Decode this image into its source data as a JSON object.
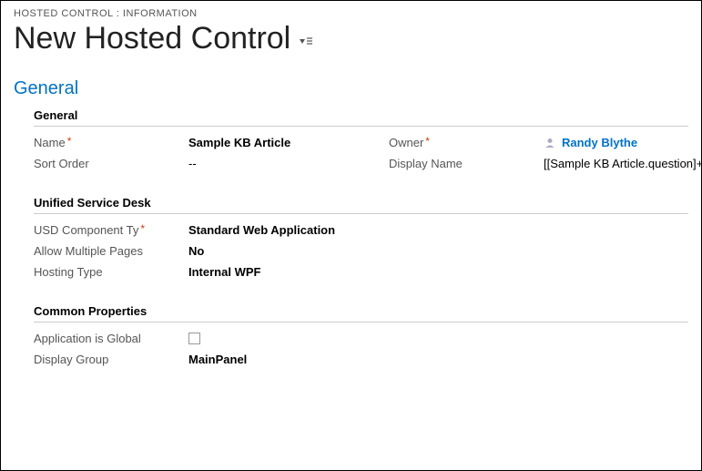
{
  "breadcrumb": "HOSTED CONTROL : INFORMATION",
  "pageTitle": "New Hosted Control",
  "sectionTab": "General",
  "sections": {
    "general": {
      "heading": "General",
      "fields": {
        "nameLabel": "Name",
        "nameValue": "Sample KB Article",
        "ownerLabel": "Owner",
        "ownerValue": "Randy Blythe",
        "sortOrderLabel": "Sort Order",
        "sortOrderValue": "--",
        "displayNameLabel": "Display Name",
        "displayNameValue": "[[Sample KB Article.question]+]"
      }
    },
    "usd": {
      "heading": "Unified Service Desk",
      "fields": {
        "componentTypeLabel": "USD Component Ty",
        "componentTypeValue": "Standard Web Application",
        "allowMultipleLabel": "Allow Multiple Pages",
        "allowMultipleValue": "No",
        "hostingTypeLabel": "Hosting Type",
        "hostingTypeValue": "Internal WPF"
      }
    },
    "common": {
      "heading": "Common Properties",
      "fields": {
        "appGlobalLabel": "Application is Global",
        "appGlobalChecked": false,
        "displayGroupLabel": "Display Group",
        "displayGroupValue": "MainPanel"
      }
    }
  }
}
